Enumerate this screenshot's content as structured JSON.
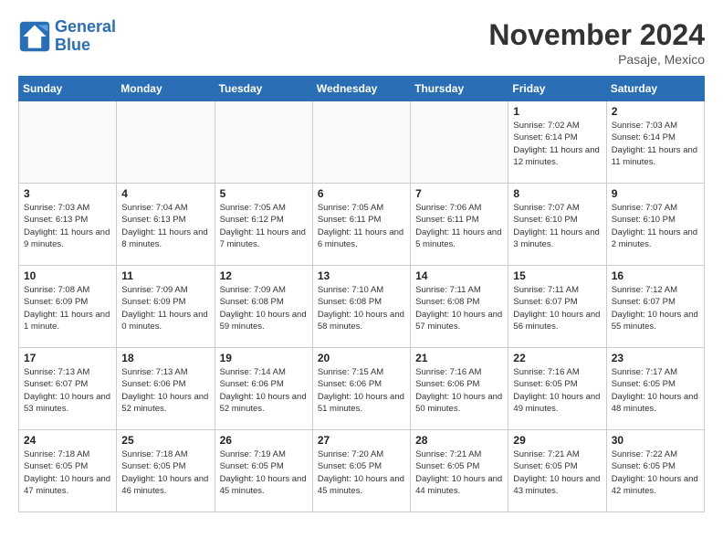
{
  "header": {
    "logo_general": "General",
    "logo_blue": "Blue",
    "month_title": "November 2024",
    "location": "Pasaje, Mexico"
  },
  "days_of_week": [
    "Sunday",
    "Monday",
    "Tuesday",
    "Wednesday",
    "Thursday",
    "Friday",
    "Saturday"
  ],
  "weeks": [
    [
      {
        "day": "",
        "info": "",
        "empty": true
      },
      {
        "day": "",
        "info": "",
        "empty": true
      },
      {
        "day": "",
        "info": "",
        "empty": true
      },
      {
        "day": "",
        "info": "",
        "empty": true
      },
      {
        "day": "",
        "info": "",
        "empty": true
      },
      {
        "day": "1",
        "info": "Sunrise: 7:02 AM\nSunset: 6:14 PM\nDaylight: 11 hours and 12 minutes."
      },
      {
        "day": "2",
        "info": "Sunrise: 7:03 AM\nSunset: 6:14 PM\nDaylight: 11 hours and 11 minutes."
      }
    ],
    [
      {
        "day": "3",
        "info": "Sunrise: 7:03 AM\nSunset: 6:13 PM\nDaylight: 11 hours and 9 minutes."
      },
      {
        "day": "4",
        "info": "Sunrise: 7:04 AM\nSunset: 6:13 PM\nDaylight: 11 hours and 8 minutes."
      },
      {
        "day": "5",
        "info": "Sunrise: 7:05 AM\nSunset: 6:12 PM\nDaylight: 11 hours and 7 minutes."
      },
      {
        "day": "6",
        "info": "Sunrise: 7:05 AM\nSunset: 6:11 PM\nDaylight: 11 hours and 6 minutes."
      },
      {
        "day": "7",
        "info": "Sunrise: 7:06 AM\nSunset: 6:11 PM\nDaylight: 11 hours and 5 minutes."
      },
      {
        "day": "8",
        "info": "Sunrise: 7:07 AM\nSunset: 6:10 PM\nDaylight: 11 hours and 3 minutes."
      },
      {
        "day": "9",
        "info": "Sunrise: 7:07 AM\nSunset: 6:10 PM\nDaylight: 11 hours and 2 minutes."
      }
    ],
    [
      {
        "day": "10",
        "info": "Sunrise: 7:08 AM\nSunset: 6:09 PM\nDaylight: 11 hours and 1 minute."
      },
      {
        "day": "11",
        "info": "Sunrise: 7:09 AM\nSunset: 6:09 PM\nDaylight: 11 hours and 0 minutes."
      },
      {
        "day": "12",
        "info": "Sunrise: 7:09 AM\nSunset: 6:08 PM\nDaylight: 10 hours and 59 minutes."
      },
      {
        "day": "13",
        "info": "Sunrise: 7:10 AM\nSunset: 6:08 PM\nDaylight: 10 hours and 58 minutes."
      },
      {
        "day": "14",
        "info": "Sunrise: 7:11 AM\nSunset: 6:08 PM\nDaylight: 10 hours and 57 minutes."
      },
      {
        "day": "15",
        "info": "Sunrise: 7:11 AM\nSunset: 6:07 PM\nDaylight: 10 hours and 56 minutes."
      },
      {
        "day": "16",
        "info": "Sunrise: 7:12 AM\nSunset: 6:07 PM\nDaylight: 10 hours and 55 minutes."
      }
    ],
    [
      {
        "day": "17",
        "info": "Sunrise: 7:13 AM\nSunset: 6:07 PM\nDaylight: 10 hours and 53 minutes."
      },
      {
        "day": "18",
        "info": "Sunrise: 7:13 AM\nSunset: 6:06 PM\nDaylight: 10 hours and 52 minutes."
      },
      {
        "day": "19",
        "info": "Sunrise: 7:14 AM\nSunset: 6:06 PM\nDaylight: 10 hours and 52 minutes."
      },
      {
        "day": "20",
        "info": "Sunrise: 7:15 AM\nSunset: 6:06 PM\nDaylight: 10 hours and 51 minutes."
      },
      {
        "day": "21",
        "info": "Sunrise: 7:16 AM\nSunset: 6:06 PM\nDaylight: 10 hours and 50 minutes."
      },
      {
        "day": "22",
        "info": "Sunrise: 7:16 AM\nSunset: 6:05 PM\nDaylight: 10 hours and 49 minutes."
      },
      {
        "day": "23",
        "info": "Sunrise: 7:17 AM\nSunset: 6:05 PM\nDaylight: 10 hours and 48 minutes."
      }
    ],
    [
      {
        "day": "24",
        "info": "Sunrise: 7:18 AM\nSunset: 6:05 PM\nDaylight: 10 hours and 47 minutes."
      },
      {
        "day": "25",
        "info": "Sunrise: 7:18 AM\nSunset: 6:05 PM\nDaylight: 10 hours and 46 minutes."
      },
      {
        "day": "26",
        "info": "Sunrise: 7:19 AM\nSunset: 6:05 PM\nDaylight: 10 hours and 45 minutes."
      },
      {
        "day": "27",
        "info": "Sunrise: 7:20 AM\nSunset: 6:05 PM\nDaylight: 10 hours and 45 minutes."
      },
      {
        "day": "28",
        "info": "Sunrise: 7:21 AM\nSunset: 6:05 PM\nDaylight: 10 hours and 44 minutes."
      },
      {
        "day": "29",
        "info": "Sunrise: 7:21 AM\nSunset: 6:05 PM\nDaylight: 10 hours and 43 minutes."
      },
      {
        "day": "30",
        "info": "Sunrise: 7:22 AM\nSunset: 6:05 PM\nDaylight: 10 hours and 42 minutes."
      }
    ]
  ]
}
